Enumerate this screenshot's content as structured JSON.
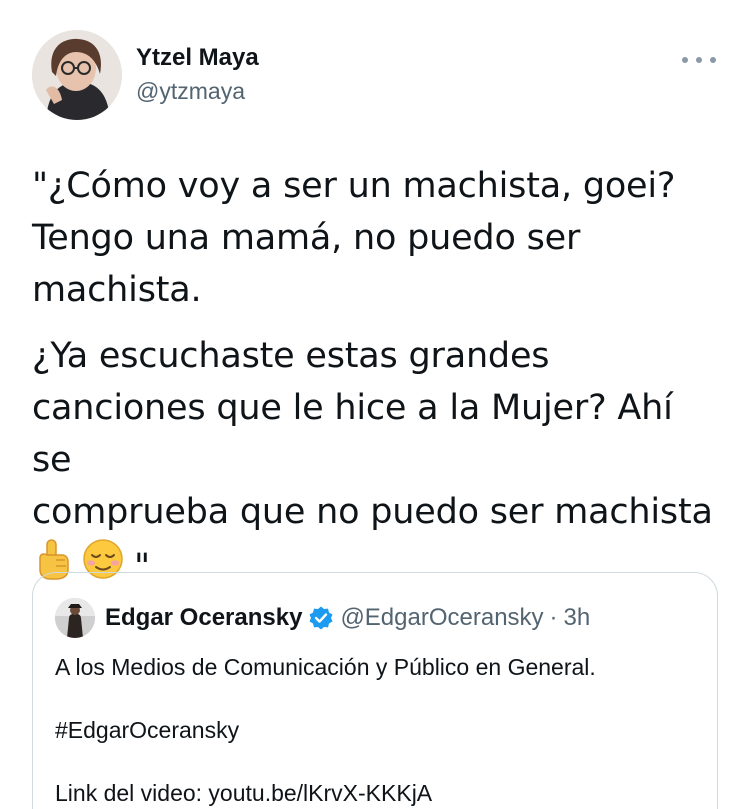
{
  "author": {
    "display_name": "Ytzel Maya",
    "handle": "@ytzmaya"
  },
  "tweet": {
    "paragraph_1": "\"¿Cómo voy a ser un machista, goei?\nTengo una mamá, no puedo ser\nmachista.",
    "paragraph_2": "¿Ya escuchaste estas grandes\ncanciones que le hice a la Mujer? Ahí se\ncomprueba que no puedo ser machista",
    "closing_quote": "\"",
    "emojis": [
      "pointing-up-emoji",
      "relieved-face-emoji"
    ]
  },
  "quoted_tweet": {
    "display_name": "Edgar Oceransky",
    "handle": "@EdgarOceransky",
    "separator": "·",
    "time": "3h",
    "line_1": "A los Medios de Comunicación y Público en General.",
    "line_2": "#EdgarOceransky",
    "line_3": "Link del video: youtu.be/lKrvX-KKKjA"
  },
  "colors": {
    "text": "#0f1419",
    "muted": "#536471",
    "border": "#cfd9de",
    "verified": "#1d9bf0"
  }
}
